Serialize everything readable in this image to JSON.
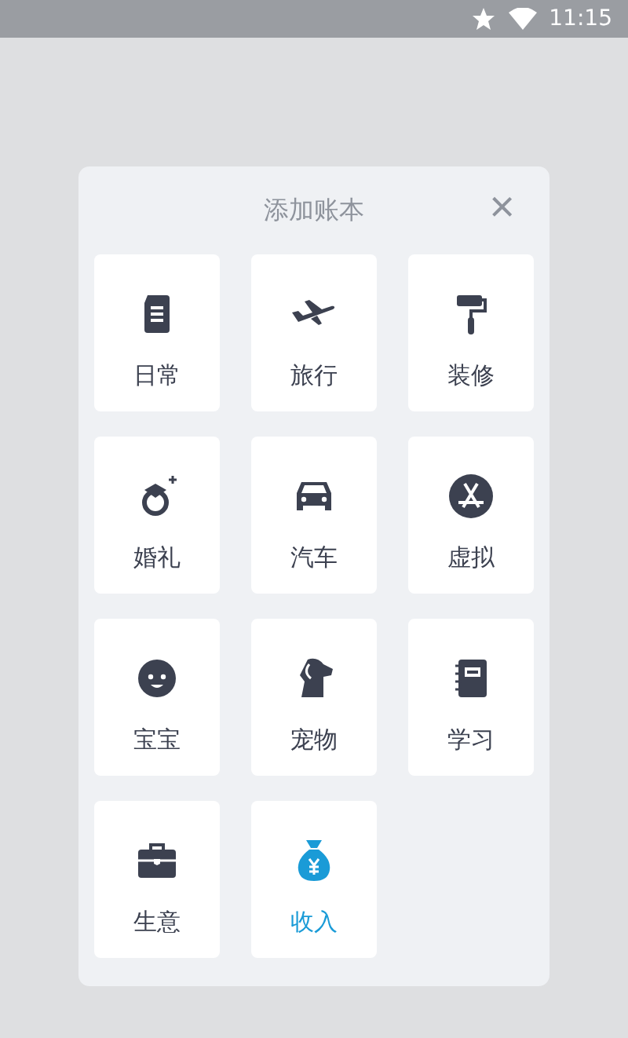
{
  "status_bar": {
    "time": "11:15"
  },
  "dialog": {
    "title": "添加账本",
    "close": "×"
  },
  "items": [
    {
      "label": "日常",
      "kind": "document",
      "color": "#3c4150"
    },
    {
      "label": "旅行",
      "kind": "plane",
      "color": "#3c4150"
    },
    {
      "label": "装修",
      "kind": "roller",
      "color": "#3c4150"
    },
    {
      "label": "婚礼",
      "kind": "ring",
      "color": "#3c4150"
    },
    {
      "label": "汽车",
      "kind": "car",
      "color": "#3c4150"
    },
    {
      "label": "虚拟",
      "kind": "appstore",
      "color": "#3c4150"
    },
    {
      "label": "宝宝",
      "kind": "baby",
      "color": "#3c4150"
    },
    {
      "label": "宠物",
      "kind": "dog",
      "color": "#3c4150"
    },
    {
      "label": "学习",
      "kind": "notebook",
      "color": "#3c4150"
    },
    {
      "label": "生意",
      "kind": "briefcase",
      "color": "#3c4150"
    },
    {
      "label": "收入",
      "kind": "moneybag",
      "color": "#1a9bd7"
    }
  ]
}
